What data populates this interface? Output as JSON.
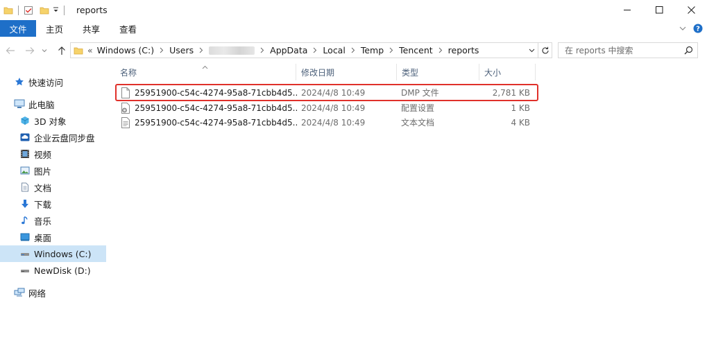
{
  "window": {
    "title": "reports",
    "controls": {
      "minimize": "—",
      "maximize": "☐",
      "close": "✕"
    }
  },
  "ribbon": {
    "tabs": [
      "文件",
      "主页",
      "共享",
      "查看"
    ]
  },
  "address": {
    "overflow": "«",
    "crumbs": [
      "Windows (C:)",
      "Users",
      "",
      "AppData",
      "Local",
      "Temp",
      "Tencent",
      "reports"
    ]
  },
  "search": {
    "placeholder": "在 reports 中搜索"
  },
  "sidebar": {
    "items": [
      {
        "label": "快速访问",
        "icon": "star-icon"
      },
      {
        "label": "此电脑",
        "icon": "computer-icon"
      },
      {
        "label": "3D 对象",
        "icon": "cube-icon"
      },
      {
        "label": "企业云盘同步盘",
        "icon": "cloud-drive-icon"
      },
      {
        "label": "视频",
        "icon": "video-icon"
      },
      {
        "label": "图片",
        "icon": "picture-icon"
      },
      {
        "label": "文档",
        "icon": "document-icon"
      },
      {
        "label": "下载",
        "icon": "download-icon"
      },
      {
        "label": "音乐",
        "icon": "music-icon"
      },
      {
        "label": "桌面",
        "icon": "desktop-icon"
      },
      {
        "label": "Windows (C:)",
        "icon": "drive-icon"
      },
      {
        "label": "NewDisk (D:)",
        "icon": "drive-icon"
      },
      {
        "label": "网络",
        "icon": "network-icon"
      }
    ],
    "selected": "Windows (C:)"
  },
  "columns": {
    "name": "名称",
    "date": "修改日期",
    "type": "类型",
    "size": "大小"
  },
  "files": [
    {
      "name": "25951900-c54c-4274-95a8-71cbb4d5...",
      "date": "2024/4/8 10:49",
      "type": "DMP 文件",
      "size": "2,781 KB",
      "icon": "blank-file-icon"
    },
    {
      "name": "25951900-c54c-4274-95a8-71cbb4d5...",
      "date": "2024/4/8 10:49",
      "type": "配置设置",
      "size": "1 KB",
      "icon": "config-file-icon"
    },
    {
      "name": "25951900-c54c-4274-95a8-71cbb4d5...",
      "date": "2024/4/8 10:49",
      "type": "文本文档",
      "size": "4 KB",
      "icon": "text-file-icon"
    }
  ],
  "colors": {
    "accent": "#1e6fc8",
    "selection": "#cce4f7",
    "highlight": "#e0302a",
    "header_text": "#4c607a"
  }
}
